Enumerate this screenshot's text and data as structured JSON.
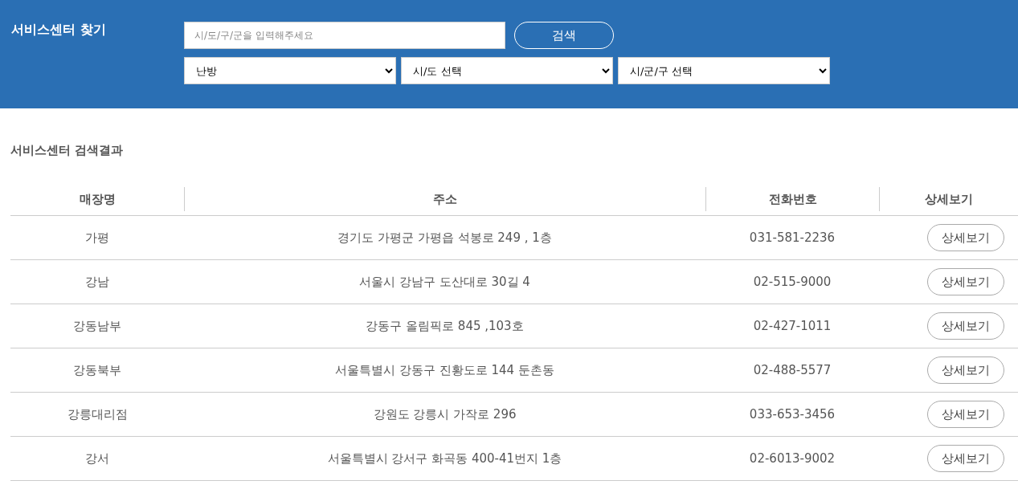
{
  "header": {
    "title": "서비스센터 찾기",
    "search": {
      "placeholder": "시/도/구/군을 입력해주세요",
      "button": "검색"
    },
    "selects": [
      {
        "value": "난방"
      },
      {
        "value": "시/도 선택"
      },
      {
        "value": "시/군/구 선택"
      }
    ]
  },
  "results": {
    "title": "서비스센터 검색결과",
    "columns": [
      "매장명",
      "주소",
      "전화번호",
      "상세보기"
    ],
    "rows": [
      {
        "name": "가평",
        "address": "경기도 가평군 가평읍 석봉로 249 , 1층",
        "phone": "031-581-2236",
        "button": "상세보기"
      },
      {
        "name": "강남",
        "address": "서울시 강남구 도산대로 30길 4",
        "phone": "02-515-9000",
        "button": "상세보기"
      },
      {
        "name": "강동남부",
        "address": "강동구 올림픽로 845 ,103호",
        "phone": "02-427-1011",
        "button": "상세보기"
      },
      {
        "name": "강동북부",
        "address": "서울특별시 강동구 진황도로 144 둔촌동",
        "phone": "02-488-5577",
        "button": "상세보기"
      },
      {
        "name": "강릉대리점",
        "address": "강원도 강릉시 가작로 296",
        "phone": "033-653-3456",
        "button": "상세보기"
      },
      {
        "name": "강서",
        "address": "서울특별시 강서구 화곡동 400-41번지 1층",
        "phone": "02-6013-9002",
        "button": "상세보기"
      }
    ]
  }
}
